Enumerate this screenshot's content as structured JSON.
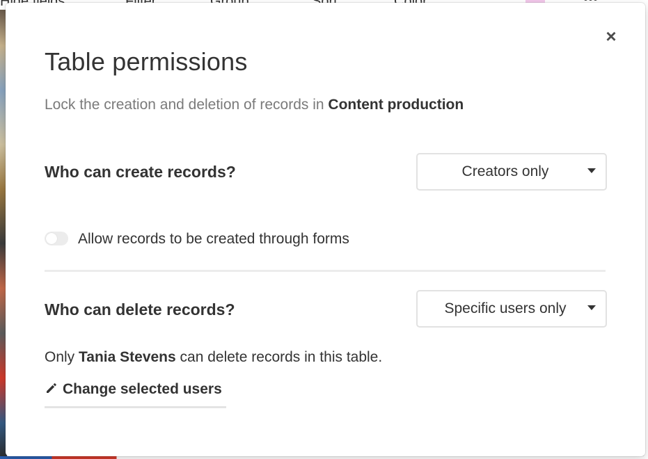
{
  "background": {
    "toolbar": [
      "Hide fields",
      "Filter",
      "Group",
      "Sort",
      "Color"
    ]
  },
  "modal": {
    "close_label": "×",
    "title": "Table permissions",
    "subtitle_prefix": "Lock the creation and deletion of records in ",
    "table_name": "Content production",
    "create": {
      "label": "Who can create records?",
      "selected": "Creators only"
    },
    "forms_toggle": {
      "label": "Allow records to be created through forms",
      "on": false
    },
    "delete": {
      "label": "Who can delete records?",
      "selected": "Specific users only"
    },
    "info": {
      "prefix": "Only ",
      "user": "Tania Stevens",
      "suffix": " can delete records in this table."
    },
    "change_users_label": "Change selected users"
  },
  "colors": {
    "text": "#333333",
    "muted": "#7a7a7a",
    "border": "#e2e2e2"
  }
}
